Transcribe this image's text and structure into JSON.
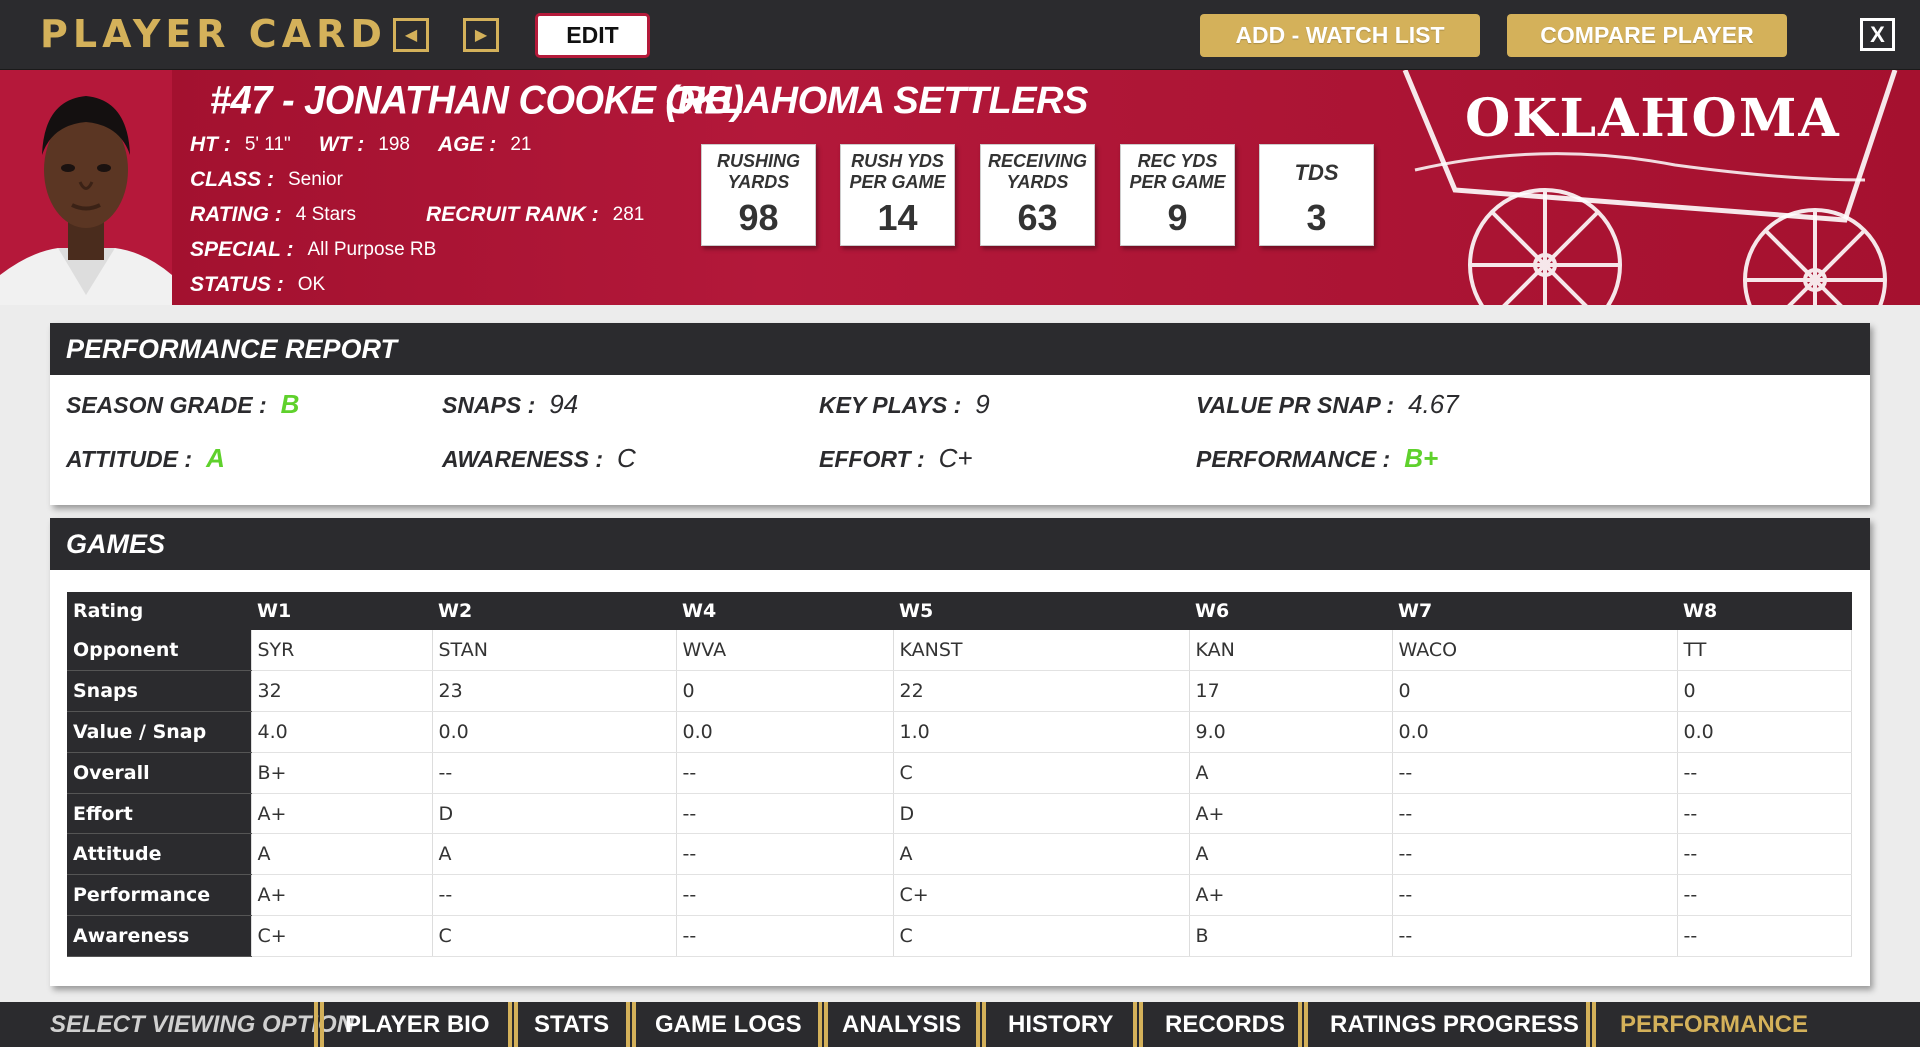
{
  "top_bar": {
    "title": "PLAYER CARD",
    "edit_label": "EDIT",
    "watch_list_label": "ADD - WATCH LIST",
    "compare_label": "COMPARE PLAYER",
    "close_label": "X"
  },
  "player": {
    "name": "#47 - JONATHAN COOKE (RB)",
    "team": "OKLAHOMA SETTLERS",
    "school_wordmark": "OKLAHOMA",
    "ht_label": "HT :",
    "ht": "5' 11\"",
    "wt_label": "WT :",
    "wt": "198",
    "age_label": "AGE :",
    "age": "21",
    "class_label": "CLASS :",
    "class": "Senior",
    "rating_label": "RATING :",
    "rating": "4 Stars",
    "recruit_label": "RECRUIT RANK :",
    "recruit_rank": "281",
    "special_label": "SPECIAL :",
    "special": "All Purpose RB",
    "status_label": "STATUS :",
    "status": "OK"
  },
  "stat_boxes": [
    {
      "label_line1": "RUSHING",
      "label_line2": "YARDS",
      "value": "98"
    },
    {
      "label_line1": "RUSH YDS",
      "label_line2": "PER GAME",
      "value": "14"
    },
    {
      "label_line1": "RECEIVING",
      "label_line2": "YARDS",
      "value": "63"
    },
    {
      "label_line1": "REC YDS",
      "label_line2": "PER GAME",
      "value": "9"
    },
    {
      "label_line1": "TDS",
      "label_line2": "",
      "value": "3"
    }
  ],
  "performance_report": {
    "heading": "PERFORMANCE REPORT",
    "season_grade_label": "SEASON GRADE :",
    "season_grade": "B",
    "snaps_label": "SNAPS :",
    "snaps": "94",
    "key_plays_label": "KEY PLAYS :",
    "key_plays": "9",
    "value_label": "VALUE PR SNAP :",
    "value_per_snap": "4.67",
    "attitude_label": "ATTITUDE :",
    "attitude": "A",
    "awareness_label": "AWARENESS :",
    "awareness": "C",
    "effort_label": "EFFORT :",
    "effort": "C+",
    "performance_label": "PERFORMANCE :",
    "performance": "B+",
    "grade_color": "#5fd12c"
  },
  "games": {
    "heading": "GAMES",
    "header": [
      "Rating",
      "W1",
      "W2",
      "W4",
      "W5",
      "W6",
      "W7",
      "W8"
    ],
    "rows": [
      [
        "Opponent",
        "SYR",
        "STAN",
        "WVA",
        "KANST",
        "KAN",
        "WACO",
        "TT"
      ],
      [
        "Snaps",
        "32",
        "23",
        "0",
        "22",
        "17",
        "0",
        "0"
      ],
      [
        "Value / Snap",
        "4.0",
        "0.0",
        "0.0",
        "1.0",
        "9.0",
        "0.0",
        "0.0"
      ],
      [
        "Overall",
        "B+",
        "--",
        "--",
        "C",
        "A",
        "--",
        "--"
      ],
      [
        "Effort",
        "A+",
        "D",
        "--",
        "D",
        "A+",
        "--",
        "--"
      ],
      [
        "Attitude",
        "A",
        "A",
        "--",
        "A",
        "A",
        "--",
        "--"
      ],
      [
        "Performance",
        "A+",
        "--",
        "--",
        "C+",
        "A+",
        "--",
        "--"
      ],
      [
        "Awareness",
        "C+",
        "C",
        "--",
        "C",
        "B",
        "--",
        "--"
      ]
    ]
  },
  "bottom_nav": {
    "select_label": "SELECT VIEWING OPTION",
    "tabs": [
      "PLAYER BIO",
      "STATS",
      "GAME LOGS",
      "ANALYSIS",
      "HISTORY",
      "RECORDS",
      "RATINGS PROGRESS",
      "PERFORMANCE"
    ],
    "active_tab": "PERFORMANCE"
  },
  "colors": {
    "accent_gold": "#d4b15a",
    "crimson": "#a5112f",
    "dark": "#2b2b2e"
  }
}
